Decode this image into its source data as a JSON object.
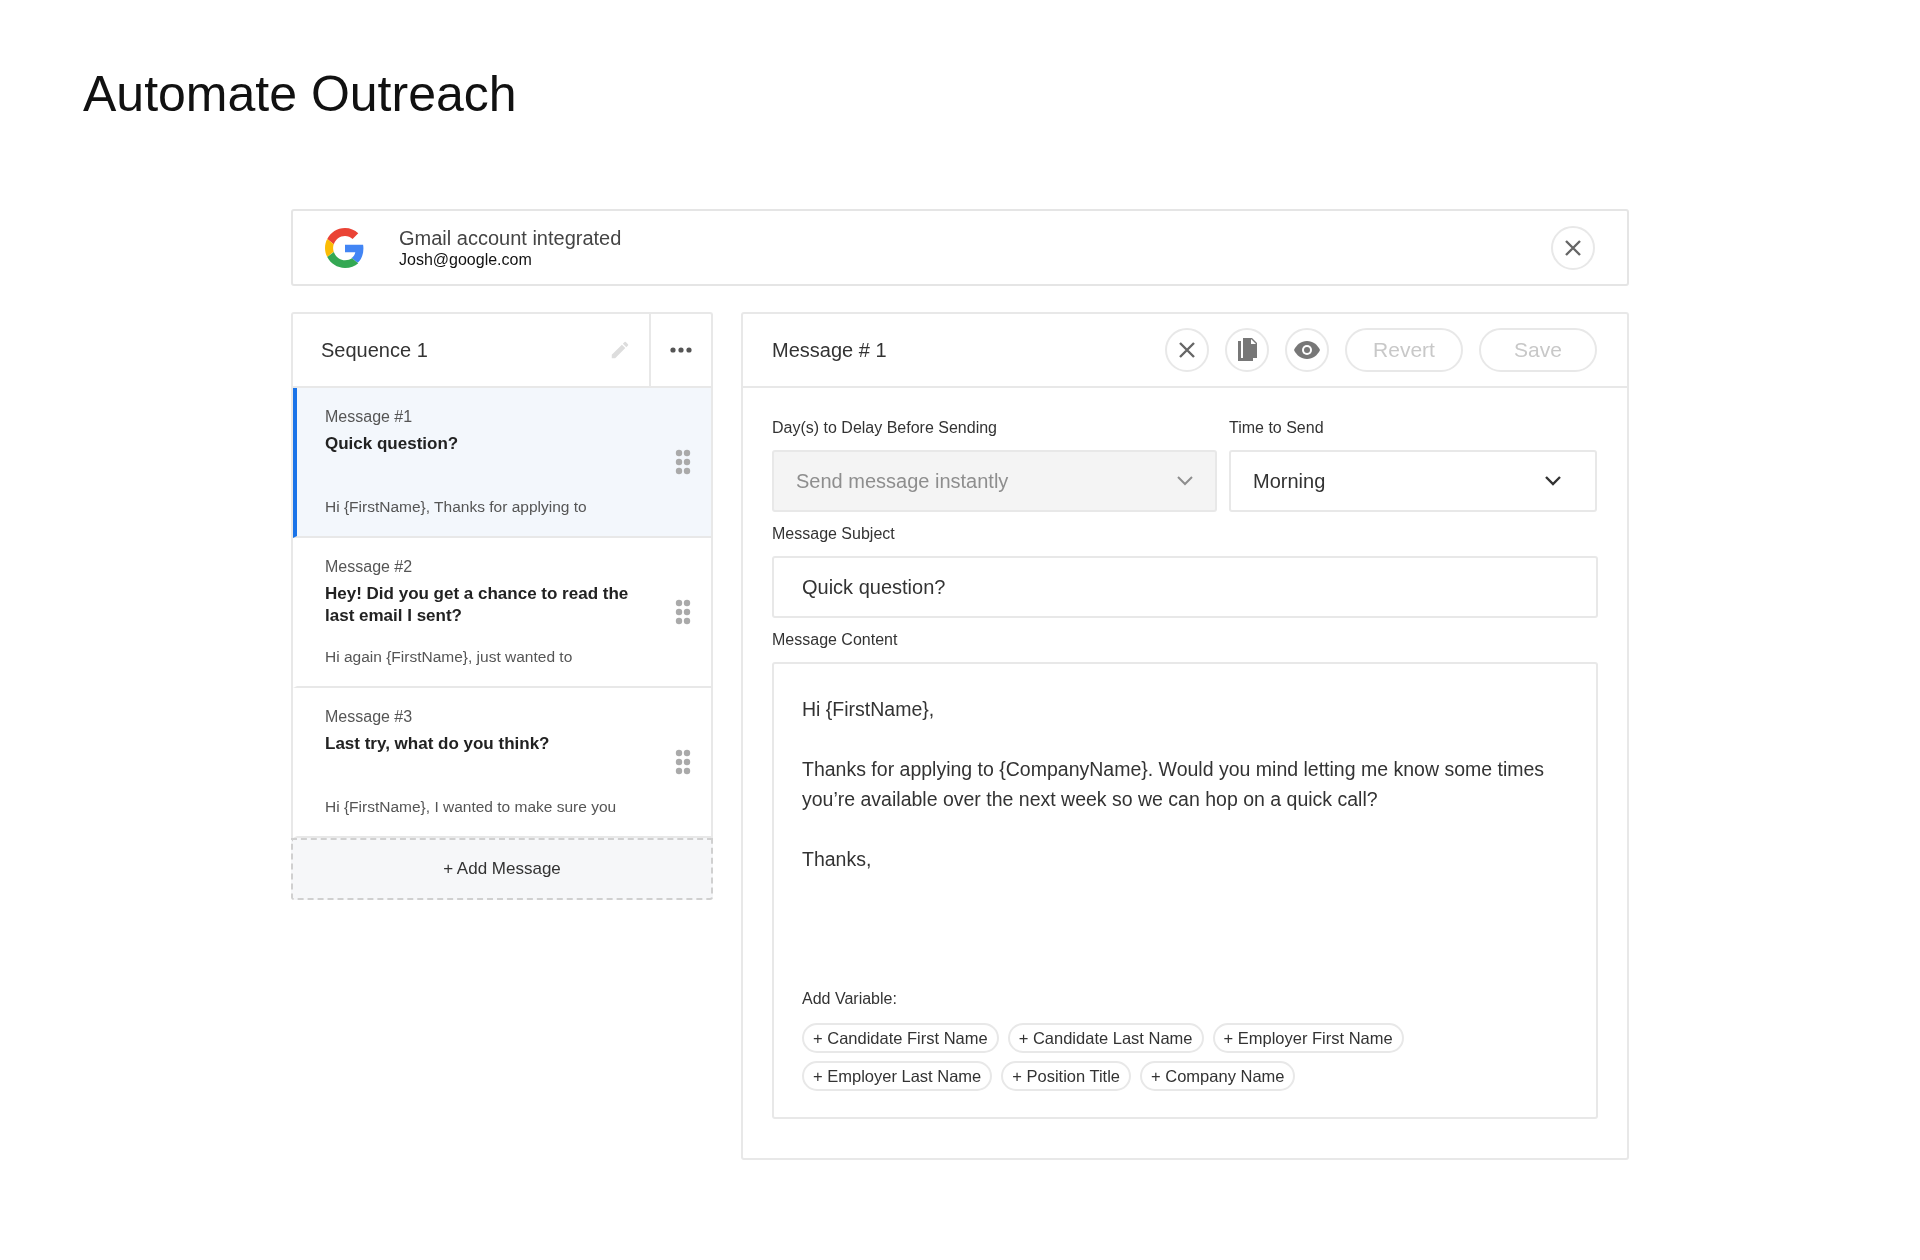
{
  "page_title": "Automate Outreach",
  "integration": {
    "title": "Gmail account integrated",
    "email": "Josh@google.com"
  },
  "sequence": {
    "title": "Sequence 1",
    "messages": [
      {
        "label": "Message #1",
        "subject": "Quick question?",
        "preview": "Hi {FirstName}, Thanks for applying to",
        "selected": true
      },
      {
        "label": "Message #2",
        "subject": "Hey! Did you get a chance to read the last email I sent?",
        "preview": "Hi again {FirstName}, just wanted to",
        "selected": false
      },
      {
        "label": "Message #3",
        "subject": "Last try, what do you think?",
        "preview": "Hi {FirstName}, I wanted to make sure you",
        "selected": false
      }
    ],
    "add_button": "+ Add Message"
  },
  "editor": {
    "title": "Message # 1",
    "actions": [
      {
        "label": "Revert",
        "disabled": true
      },
      {
        "label": "Save",
        "disabled": true
      }
    ],
    "delay": {
      "label": "Day(s) to Delay Before Sending",
      "value": "Send message instantly",
      "disabled": true
    },
    "time": {
      "label": "Time to Send",
      "value": "Morning",
      "disabled": false
    },
    "subject": {
      "label": "Message Subject",
      "value": "Quick question?"
    },
    "content": {
      "label": "Message Content",
      "paragraphs": [
        "Hi {FirstName},",
        "Thanks for applying to {CompanyName}. Would you mind letting me know some times you’re available over the next week so we can hop on a quick call?",
        "Thanks,"
      ]
    },
    "variables_label": "Add Variable:",
    "variables": [
      "+ Candidate First Name",
      "+ Candidate Last Name",
      "+ Employer First Name",
      "+ Employer Last Name",
      "+ Position Title",
      "+ Company Name"
    ]
  }
}
